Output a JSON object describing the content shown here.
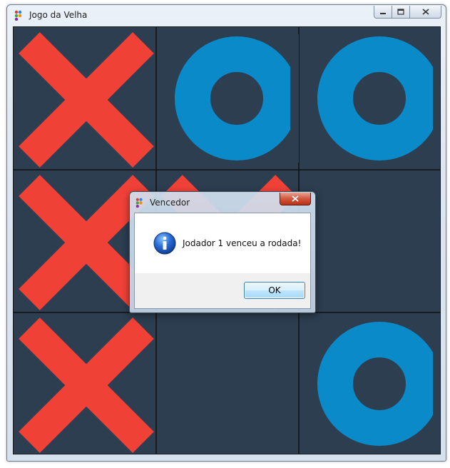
{
  "window": {
    "title": "Jogo da Velha",
    "caption_buttons": [
      "minimize",
      "maximize",
      "close"
    ]
  },
  "board": {
    "background": "#2c3e50",
    "grid_color": "#111111",
    "x_color": "#f04137",
    "o_color": "#0b8ac9",
    "cells": [
      "X",
      "O",
      "O",
      "X",
      "X",
      "",
      "X",
      "",
      "O"
    ]
  },
  "dialog": {
    "title": "Vencedor",
    "icon": "info-icon",
    "message": "Jodador 1 venceu a rodada!",
    "ok_label": "OK"
  }
}
